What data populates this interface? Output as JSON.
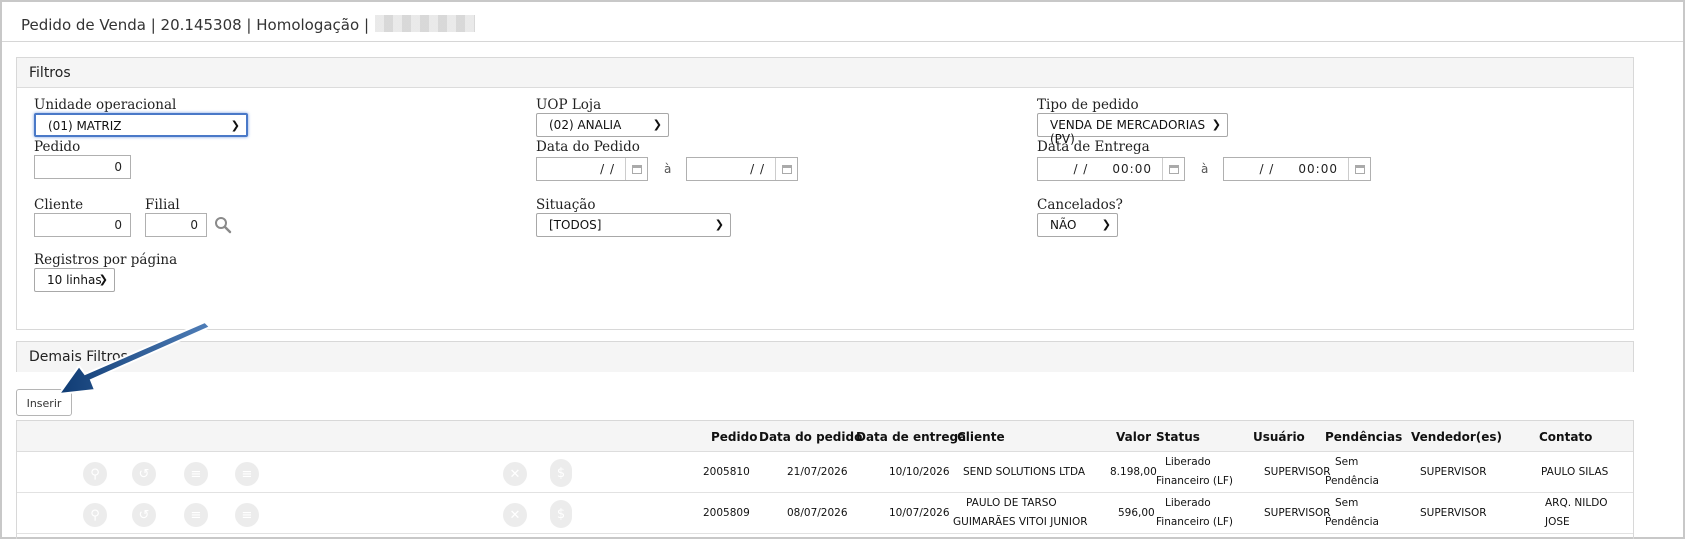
{
  "header": {
    "title": "Pedido de Venda | 20.145308 | Homologação |"
  },
  "filters": {
    "heading": "Filtros",
    "unidade_label": "Unidade operacional",
    "unidade_value": "(01) MATRIZ",
    "uop_label": "UOP Loja",
    "uop_value": "(02) ANALIA",
    "tipo_label": "Tipo de pedido",
    "tipo_value": "VENDA DE MERCADORIAS (PV)",
    "pedido_label": "Pedido",
    "pedido_value": "0",
    "data_pedido_label": "Data do Pedido",
    "data_pedido_from": "/ /",
    "data_pedido_to": "/ /",
    "data_entrega_label": "Data de Entrega",
    "data_entrega_from": "/ /     00:00",
    "data_entrega_to": "/ /     00:00",
    "range_sep": "à",
    "cliente_label": "Cliente",
    "cliente_value": "0",
    "filial_label": "Filial",
    "filial_value": "0",
    "situacao_label": "Situação",
    "situacao_value": "[TODOS]",
    "cancelados_label": "Cancelados?",
    "cancelados_value": "NÃO",
    "registros_label": "Registros por página",
    "registros_value": "10 linhas"
  },
  "demais": {
    "heading": "Demais Filtros"
  },
  "actions": {
    "inserir": "Inserir"
  },
  "table": {
    "headers": {
      "pedido": "Pedido",
      "data_pedido": "Data do pedido",
      "data_entrega": "Data de entrega",
      "cliente": "Cliente",
      "valor": "Valor",
      "status": "Status",
      "usuario": "Usuário",
      "pendencias": "Pendências",
      "vendedores": "Vendedor(es)",
      "contato": "Contato"
    },
    "rows": [
      {
        "pedido": "2005810",
        "data_pedido": "21/07/2026",
        "data_entrega": "10/10/2026",
        "cliente_1": "SEND SOLUTIONS LTDA",
        "cliente_2": "",
        "valor": "8.198,00",
        "status_1": "Liberado",
        "status_2": "Financeiro (LF)",
        "usuario": "SUPERVISOR",
        "pend_1": "Sem",
        "pend_2": "Pendência",
        "vendedor": "SUPERVISOR",
        "contato_1": "PAULO SILAS",
        "contato_2": ""
      },
      {
        "pedido": "2005809",
        "data_pedido": "08/07/2026",
        "data_entrega": "10/07/2026",
        "cliente_1": "PAULO DE TARSO",
        "cliente_2": "GUIMARÃES VITOI JUNIOR",
        "valor": "596,00",
        "status_1": "Liberado",
        "status_2": "Financeiro (LF)",
        "usuario": "SUPERVISOR",
        "pend_1": "Sem",
        "pend_2": "Pendência",
        "vendedor": "SUPERVISOR",
        "contato_1": "ARQ. NILDO",
        "contato_2": "JOSE"
      }
    ]
  },
  "icons": {
    "row_actions": [
      "search-icon",
      "history-icon",
      "list-icon",
      "menu-icon",
      "cancel-icon",
      "dollar-icon"
    ]
  }
}
